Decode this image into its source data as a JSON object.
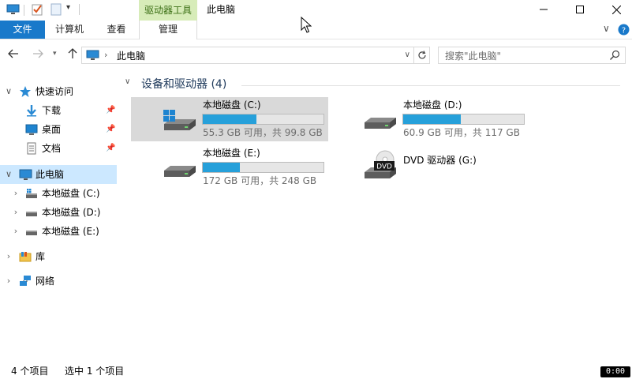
{
  "window": {
    "title": "此电脑",
    "context_tab": "驱动器工具",
    "accent_color": "#1979ca",
    "context_color": "#d7ecb9"
  },
  "ribbon": {
    "file_tab": "文件",
    "tabs": [
      "计算机",
      "查看"
    ],
    "manage_tab": "管理"
  },
  "address": {
    "path": "此电脑",
    "search_placeholder": "搜索\"此电脑\""
  },
  "nav": {
    "quick_access": "快速访问",
    "quick_items": [
      {
        "label": "下载",
        "icon": "download-icon"
      },
      {
        "label": "桌面",
        "icon": "desktop-icon"
      },
      {
        "label": "文档",
        "icon": "document-icon"
      }
    ],
    "this_pc": "此电脑",
    "drives": [
      {
        "label": "本地磁盘 (C:)",
        "icon": "windows-drive-icon"
      },
      {
        "label": "本地磁盘 (D:)",
        "icon": "drive-icon"
      },
      {
        "label": "本地磁盘 (E:)",
        "icon": "drive-icon"
      }
    ],
    "libraries": "库",
    "network": "网络"
  },
  "content": {
    "group_title": "设备和驱动器 (4)",
    "drives": [
      {
        "name": "本地磁盘 (C:)",
        "info": "55.3 GB 可用，共 99.8 GB",
        "used_fraction": 0.446,
        "icon": "windows-drive-icon"
      },
      {
        "name": "本地磁盘 (D:)",
        "info": "60.9 GB 可用，共 117 GB",
        "used_fraction": 0.479,
        "icon": "drive-icon"
      },
      {
        "name": "本地磁盘 (E:)",
        "info": "172 GB 可用，共 248 GB",
        "used_fraction": 0.306,
        "icon": "drive-icon"
      },
      {
        "name": "DVD 驱动器 (G:)",
        "icon": "dvd-drive-icon",
        "icon_label": "DVD"
      }
    ]
  },
  "status": {
    "item_count": "4 个项目",
    "selected": "选中 1 个项目",
    "clock": "0:00"
  }
}
